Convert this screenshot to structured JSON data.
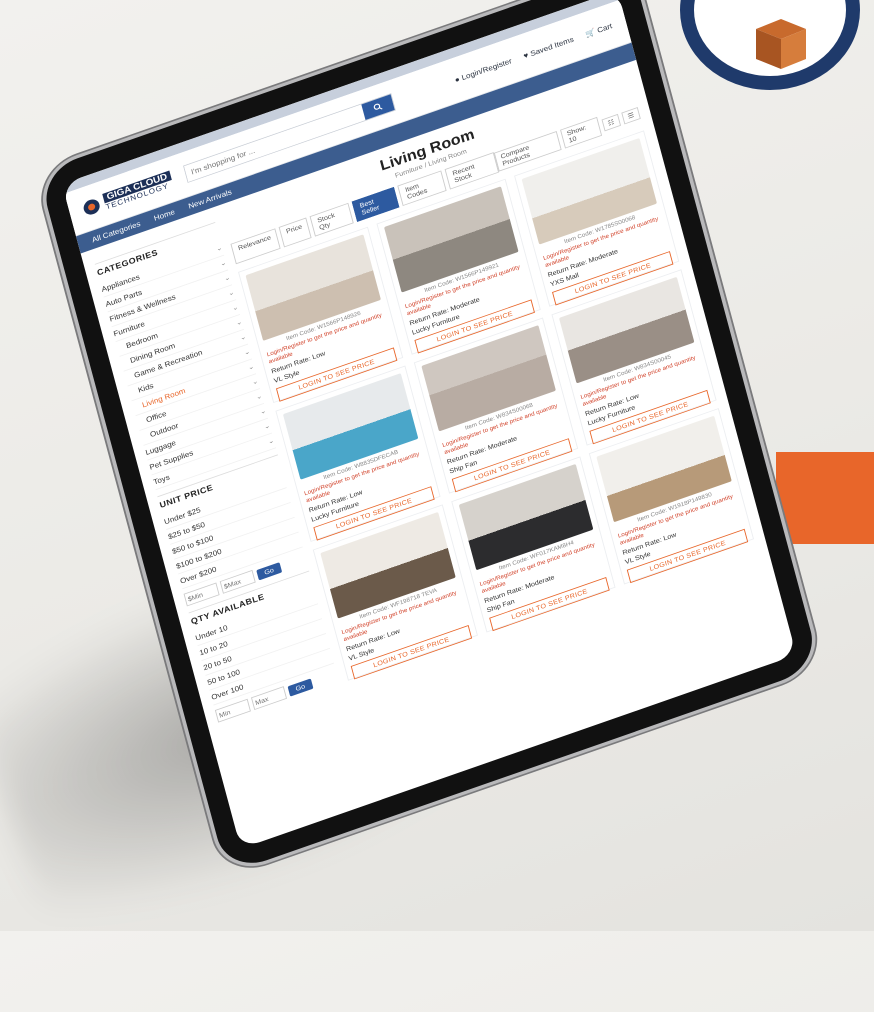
{
  "site": {
    "logo_main": "GIGA CLOUD",
    "logo_sub": "TECHNOLOGY",
    "search_placeholder": "I'm shopping for ...",
    "user": "Login/Register",
    "saved": "Saved Items",
    "cart": "Cart"
  },
  "nav": {
    "items": [
      "All Categories",
      "Home",
      "New Arrivals"
    ]
  },
  "page": {
    "title": "Living Room",
    "breadcrumb": "Furniture / Living Room"
  },
  "controls": {
    "sort": [
      "Relevance",
      "Price",
      "Stock Qty",
      "Best Seller",
      "Item Codes",
      "Recent Stock"
    ],
    "show_label": "Show: 10",
    "view1": "☷",
    "view2": "☰",
    "compare": "Compare Products"
  },
  "sidebar": {
    "categories_title": "CATEGORIES",
    "categories": [
      {
        "label": "Appliances",
        "sub": false
      },
      {
        "label": "Auto Parts",
        "sub": false
      },
      {
        "label": "Fitness & Wellness",
        "sub": false
      },
      {
        "label": "Furniture",
        "sub": false
      },
      {
        "label": "Bedroom",
        "sub": true
      },
      {
        "label": "Dining Room",
        "sub": true
      },
      {
        "label": "Game & Recreation",
        "sub": true
      },
      {
        "label": "Kids",
        "sub": true
      },
      {
        "label": "Living Room",
        "sub": true,
        "active": true
      },
      {
        "label": "Office",
        "sub": true
      },
      {
        "label": "Outdoor",
        "sub": true
      },
      {
        "label": "Luggage",
        "sub": false
      },
      {
        "label": "Pet Supplies",
        "sub": false
      },
      {
        "label": "Toys",
        "sub": false
      }
    ],
    "unit_price_title": "UNIT PRICE",
    "unit_price": [
      "Under $25",
      "$25 to $50",
      "$50 to $100",
      "$100 to $200",
      "Over $200"
    ],
    "min_ph": "$Min",
    "max_ph": "$Max",
    "go": "Go",
    "qty_title": "QTY AVAILABLE",
    "qty": [
      "Under 10",
      "10 to 20",
      "20 to 50",
      "50 to 100",
      "Over 100"
    ],
    "qmin_ph": "Min",
    "qmax_ph": "Max"
  },
  "products": [
    {
      "code": "Item Code: W1566P148926",
      "note": "Login/Register to get the price and quantity available",
      "line1": "Return Rate: Low",
      "line2": "VL Style",
      "btn": "LOGIN TO SEE PRICE"
    },
    {
      "code": "Item Code: W1566P149921",
      "note": "Login/Register to get the price and quantity available",
      "line1": "Return Rate: Moderate",
      "line2": "Lucky Furniture",
      "btn": "LOGIN TO SEE PRICE"
    },
    {
      "code": "Item Code: W1785S00068",
      "note": "Login/Register to get the price and quantity available",
      "line1": "Return Rate: Moderate",
      "line2": "YXS Mall",
      "btn": "LOGIN TO SEE PRICE"
    },
    {
      "code": "Item Code: W8835DFECAB",
      "note": "Login/Register to get the price and quantity available",
      "line1": "Return Rate: Low",
      "line2": "Lucky Furniture",
      "btn": "LOGIN TO SEE PRICE"
    },
    {
      "code": "Item Code: W834S00068",
      "note": "Login/Register to get the price and quantity available",
      "line1": "Return Rate: Moderate",
      "line2": "Ship Fan",
      "btn": "LOGIN TO SEE PRICE"
    },
    {
      "code": "Item Code: W834S00045",
      "note": "Login/Register to get the price and quantity available",
      "line1": "Return Rate: Low",
      "line2": "Lucky Furniture",
      "btn": "LOGIN TO SEE PRICE"
    },
    {
      "code": "Item Code: WF198718 TEVA",
      "note": "Login/Register to get the price and quantity available",
      "line1": "Return Rate: Low",
      "line2": "VL Style",
      "btn": "LOGIN TO SEE PRICE"
    },
    {
      "code": "Item Code: WF017KAM8H4",
      "note": "Login/Register to get the price and quantity available",
      "line1": "Return Rate: Moderate",
      "line2": "Ship Fan",
      "btn": "LOGIN TO SEE PRICE"
    },
    {
      "code": "Item Code: W1918P149830",
      "note": "Login/Register to get the price and quantity available",
      "line1": "Return Rate: Low",
      "line2": "VL Style",
      "btn": "LOGIN TO SEE PRICE"
    }
  ],
  "colors": {
    "brand_navy": "#1c2f57",
    "accent_orange": "#e8662a",
    "primary_blue": "#2d5aa0"
  }
}
